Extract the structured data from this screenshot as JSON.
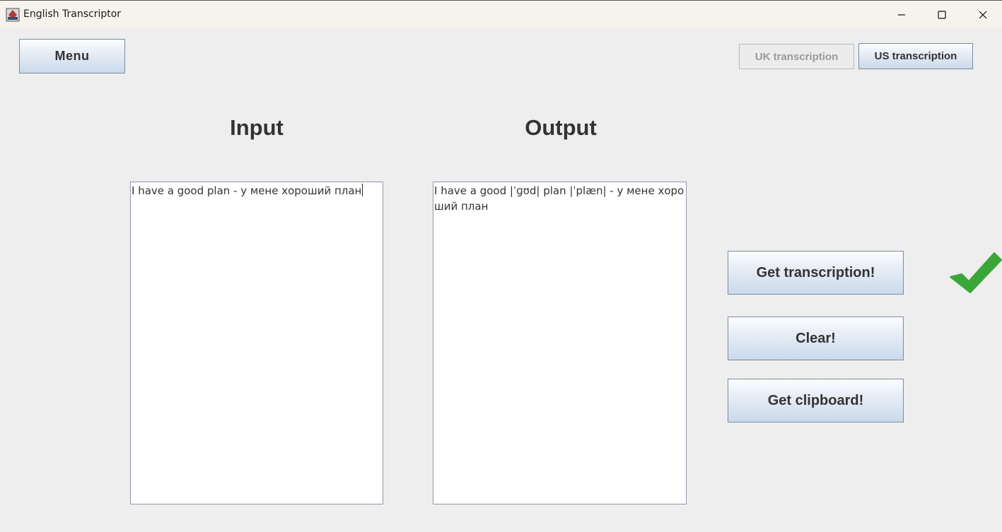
{
  "window": {
    "title": "English Transcriptor",
    "controls": {
      "minimize": "minimize-icon",
      "maximize": "maximize-icon",
      "close": "close-icon"
    }
  },
  "toolbar": {
    "menu_label": "Menu",
    "uk_label": "UK transcription",
    "us_label": "US transcription",
    "uk_enabled": false
  },
  "main": {
    "input_heading": "Input",
    "output_heading": "Output",
    "input_text": "I have a good plan - у мене хороший план",
    "output_text": "I have a good |ˈɡʊd| plan |ˈplæn| - у мене хороший план"
  },
  "actions": {
    "get_transcription_label": "Get transcription!",
    "clear_label": "Clear!",
    "get_clipboard_label": "Get clipboard!"
  },
  "status": {
    "icon": "checkmark-icon",
    "color": "#3aa63a"
  }
}
